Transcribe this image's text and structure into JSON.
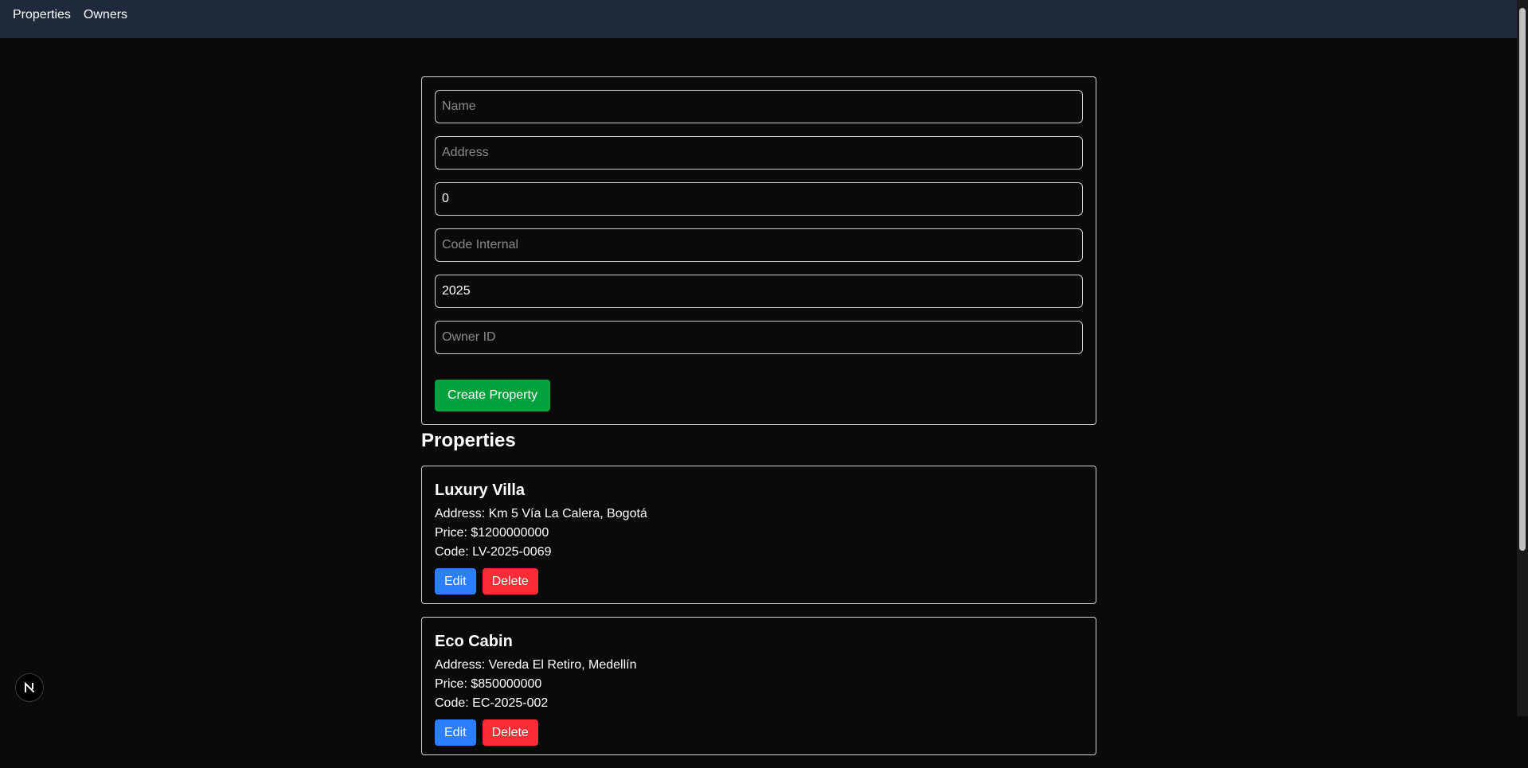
{
  "nav": {
    "links": [
      "Properties",
      "Owners"
    ]
  },
  "form": {
    "name_placeholder": "Name",
    "name_value": "",
    "address_placeholder": "Address",
    "address_value": "",
    "price_value": "0",
    "code_placeholder": "Code Internal",
    "code_value": "",
    "year_value": "2025",
    "owner_placeholder": "Owner ID",
    "owner_value": "",
    "submit_label": "Create Property"
  },
  "list": {
    "title": "Properties",
    "edit_label": "Edit",
    "delete_label": "Delete",
    "items": [
      {
        "name": "Luxury Villa",
        "address": "Address: Km 5 Vía La Calera, Bogotá",
        "price": "Price: $1200000000",
        "code": "Code: LV-2025-0069"
      },
      {
        "name": "Eco Cabin",
        "address": "Address: Vereda El Retiro, Medellín",
        "price": "Price: $850000000",
        "code": "Code: EC-2025-002"
      }
    ]
  },
  "badge": {
    "letter": "N",
    "icon": "nextjs-logo-icon"
  },
  "colors": {
    "background": "#0a0a0a",
    "navbar": "#1e293b",
    "create_button": "#00a23d",
    "edit_button": "#2b7fff",
    "delete_button": "#fb2c36"
  }
}
